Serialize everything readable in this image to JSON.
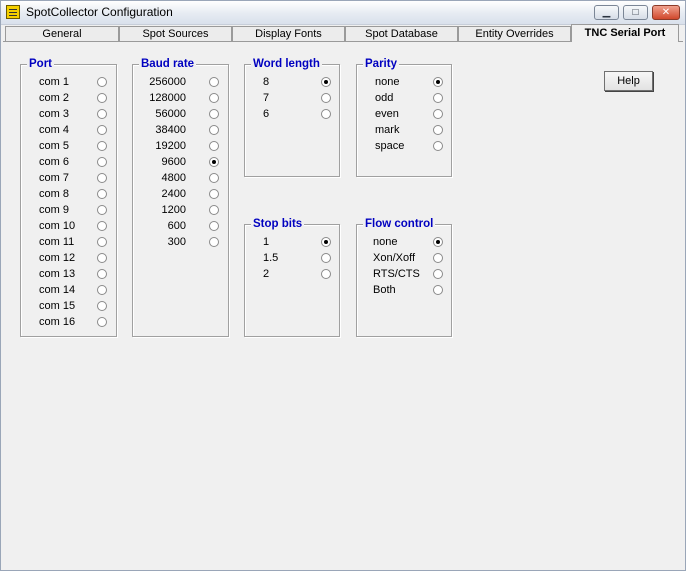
{
  "window": {
    "title": "SpotCollector Configuration"
  },
  "tabs": [
    {
      "label": "General",
      "active": false
    },
    {
      "label": "Spot Sources",
      "active": false
    },
    {
      "label": "Display Fonts",
      "active": false
    },
    {
      "label": "Spot Database",
      "active": false
    },
    {
      "label": "Entity Overrides",
      "active": false
    },
    {
      "label": "TNC Serial Port",
      "active": true
    }
  ],
  "port": {
    "legend": "Port",
    "options": [
      "com 1",
      "com 2",
      "com 3",
      "com 4",
      "com 5",
      "com 6",
      "com 7",
      "com 8",
      "com 9",
      "com 10",
      "com 11",
      "com 12",
      "com 13",
      "com 14",
      "com 15",
      "com 16"
    ],
    "selected": null
  },
  "baud": {
    "legend": "Baud rate",
    "options": [
      "256000",
      "128000",
      "56000",
      "38400",
      "19200",
      "9600",
      "4800",
      "2400",
      "1200",
      "600",
      "300"
    ],
    "selected": "9600"
  },
  "word_length": {
    "legend": "Word length",
    "options": [
      "8",
      "7",
      "6"
    ],
    "selected": "8"
  },
  "parity": {
    "legend": "Parity",
    "options": [
      "none",
      "odd",
      "even",
      "mark",
      "space"
    ],
    "selected": "none"
  },
  "stop_bits": {
    "legend": "Stop bits",
    "options": [
      "1",
      "1.5",
      "2"
    ],
    "selected": "1"
  },
  "flow_control": {
    "legend": "Flow control",
    "options": [
      "none",
      "Xon/Xoff",
      "RTS/CTS",
      "Both"
    ],
    "selected": "none"
  },
  "help_label": "Help",
  "colors": {
    "legend": "#0000c0",
    "background": "#f0f0f0"
  }
}
